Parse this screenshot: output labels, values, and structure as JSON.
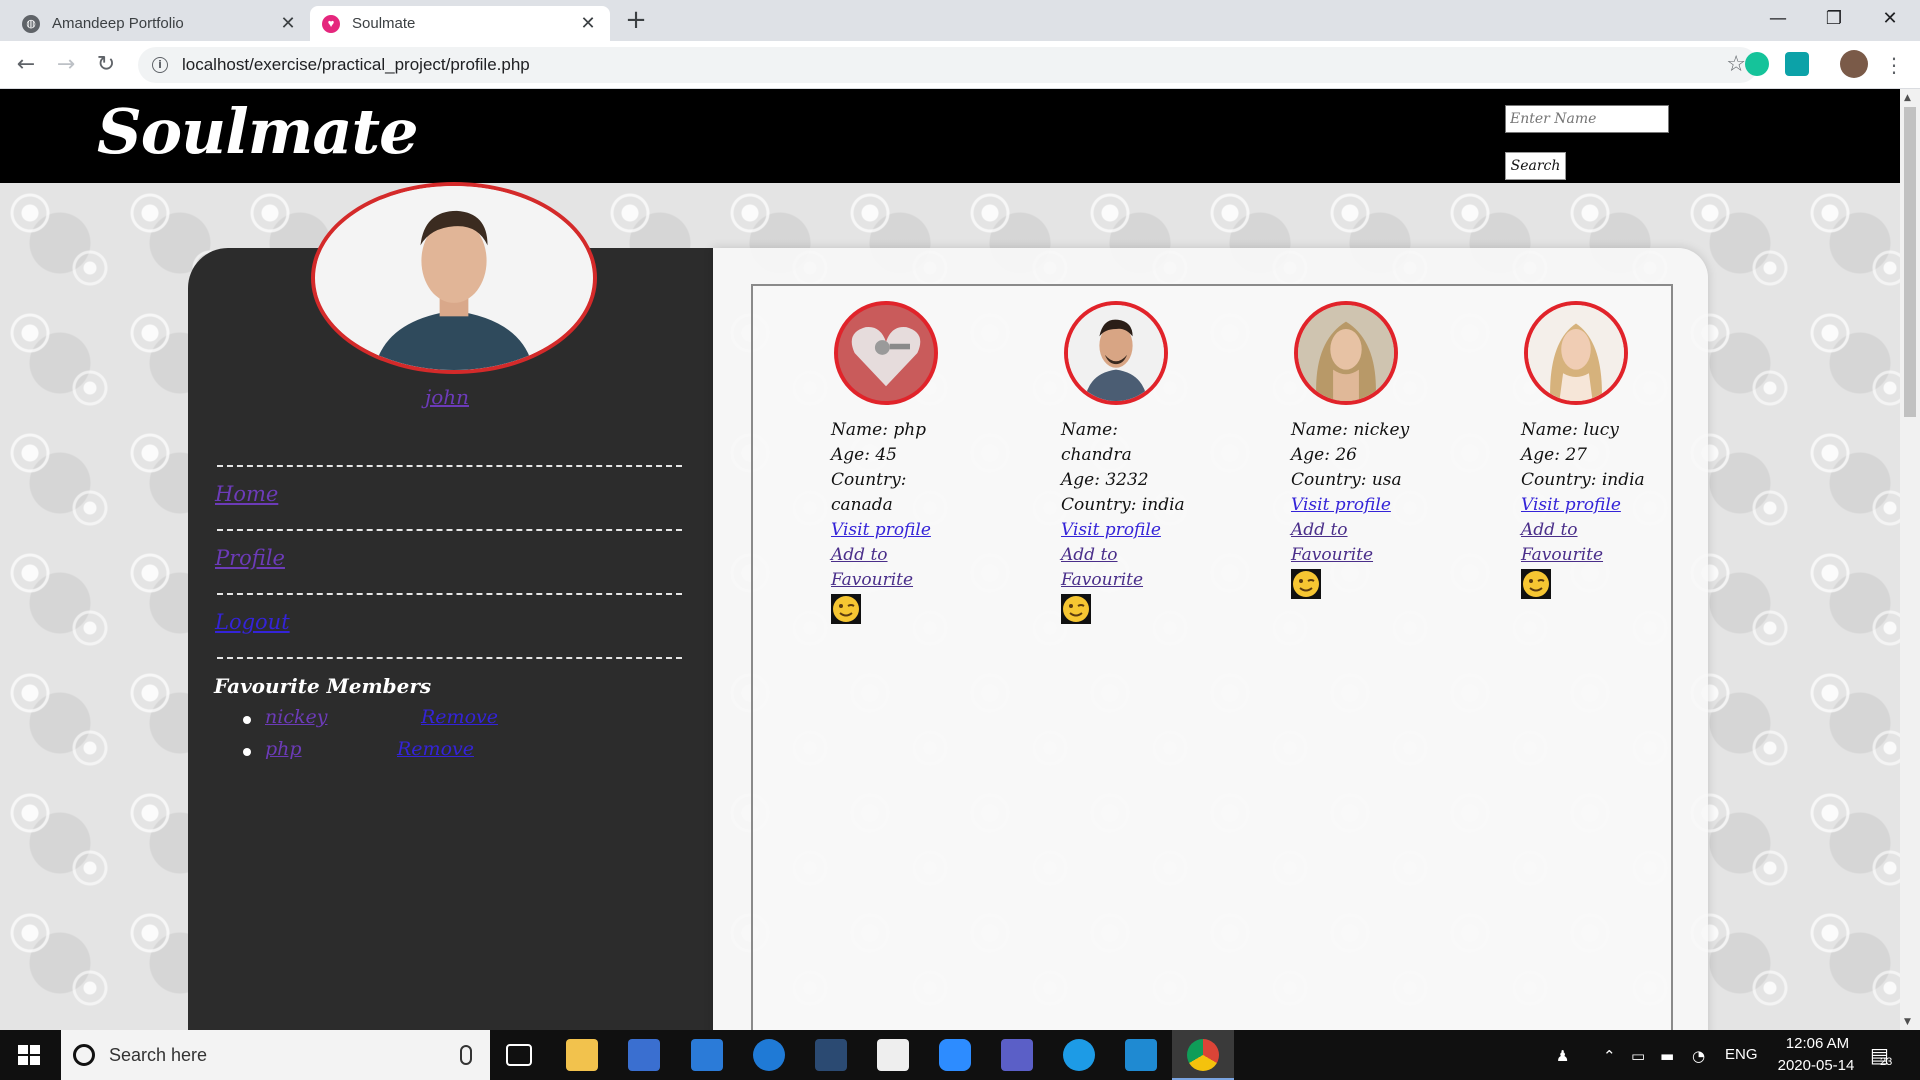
{
  "browser": {
    "tabs": [
      {
        "title": "Amandeep Portfolio",
        "active": false
      },
      {
        "title": "Soulmate",
        "active": true
      }
    ],
    "url": "localhost/exercise/practical_project/profile.php"
  },
  "site": {
    "logo": "Soulmate",
    "search_placeholder": "Enter Name",
    "search_button": "Search"
  },
  "sidebar": {
    "username": "john",
    "links": [
      "Home",
      "Profile",
      "Logout"
    ],
    "favourites_heading": "Favourite Members",
    "favourites": [
      {
        "name": "nickey",
        "remove": "Remove"
      },
      {
        "name": "php",
        "remove": "Remove"
      }
    ]
  },
  "members": [
    {
      "name": "Name: php",
      "age": "Age: 45",
      "country_label": "Country:",
      "country": "canada",
      "visit": "Visit profile",
      "add_1": "Add to",
      "add_2": "Favourite"
    },
    {
      "name": "Name: chandra",
      "age": "Age: 3232",
      "country_label": "Country: india",
      "country": "",
      "visit": "Visit profile",
      "add_1": "Add to",
      "add_2": "Favourite"
    },
    {
      "name": "Name: nickey",
      "age": "Age: 26",
      "country_label": "Country: usa",
      "country": "",
      "visit": "Visit profile",
      "add_1": "Add to",
      "add_2": "Favourite"
    },
    {
      "name": "Name: lucy",
      "age": "Age: 27",
      "country_label": "Country: india",
      "country": "",
      "visit": "Visit profile",
      "add_1": "Add to",
      "add_2": "Favourite"
    }
  ],
  "taskbar": {
    "search_placeholder": "Search here",
    "language": "ENG",
    "time": "12:06 AM",
    "date": "2020-05-14",
    "notification_count": "23"
  },
  "colors": {
    "accent_red": "#e1232a",
    "link_blue": "#3423d8",
    "visited_purple": "#6c3bb8",
    "sidebar_bg": "#2c2c2c"
  }
}
